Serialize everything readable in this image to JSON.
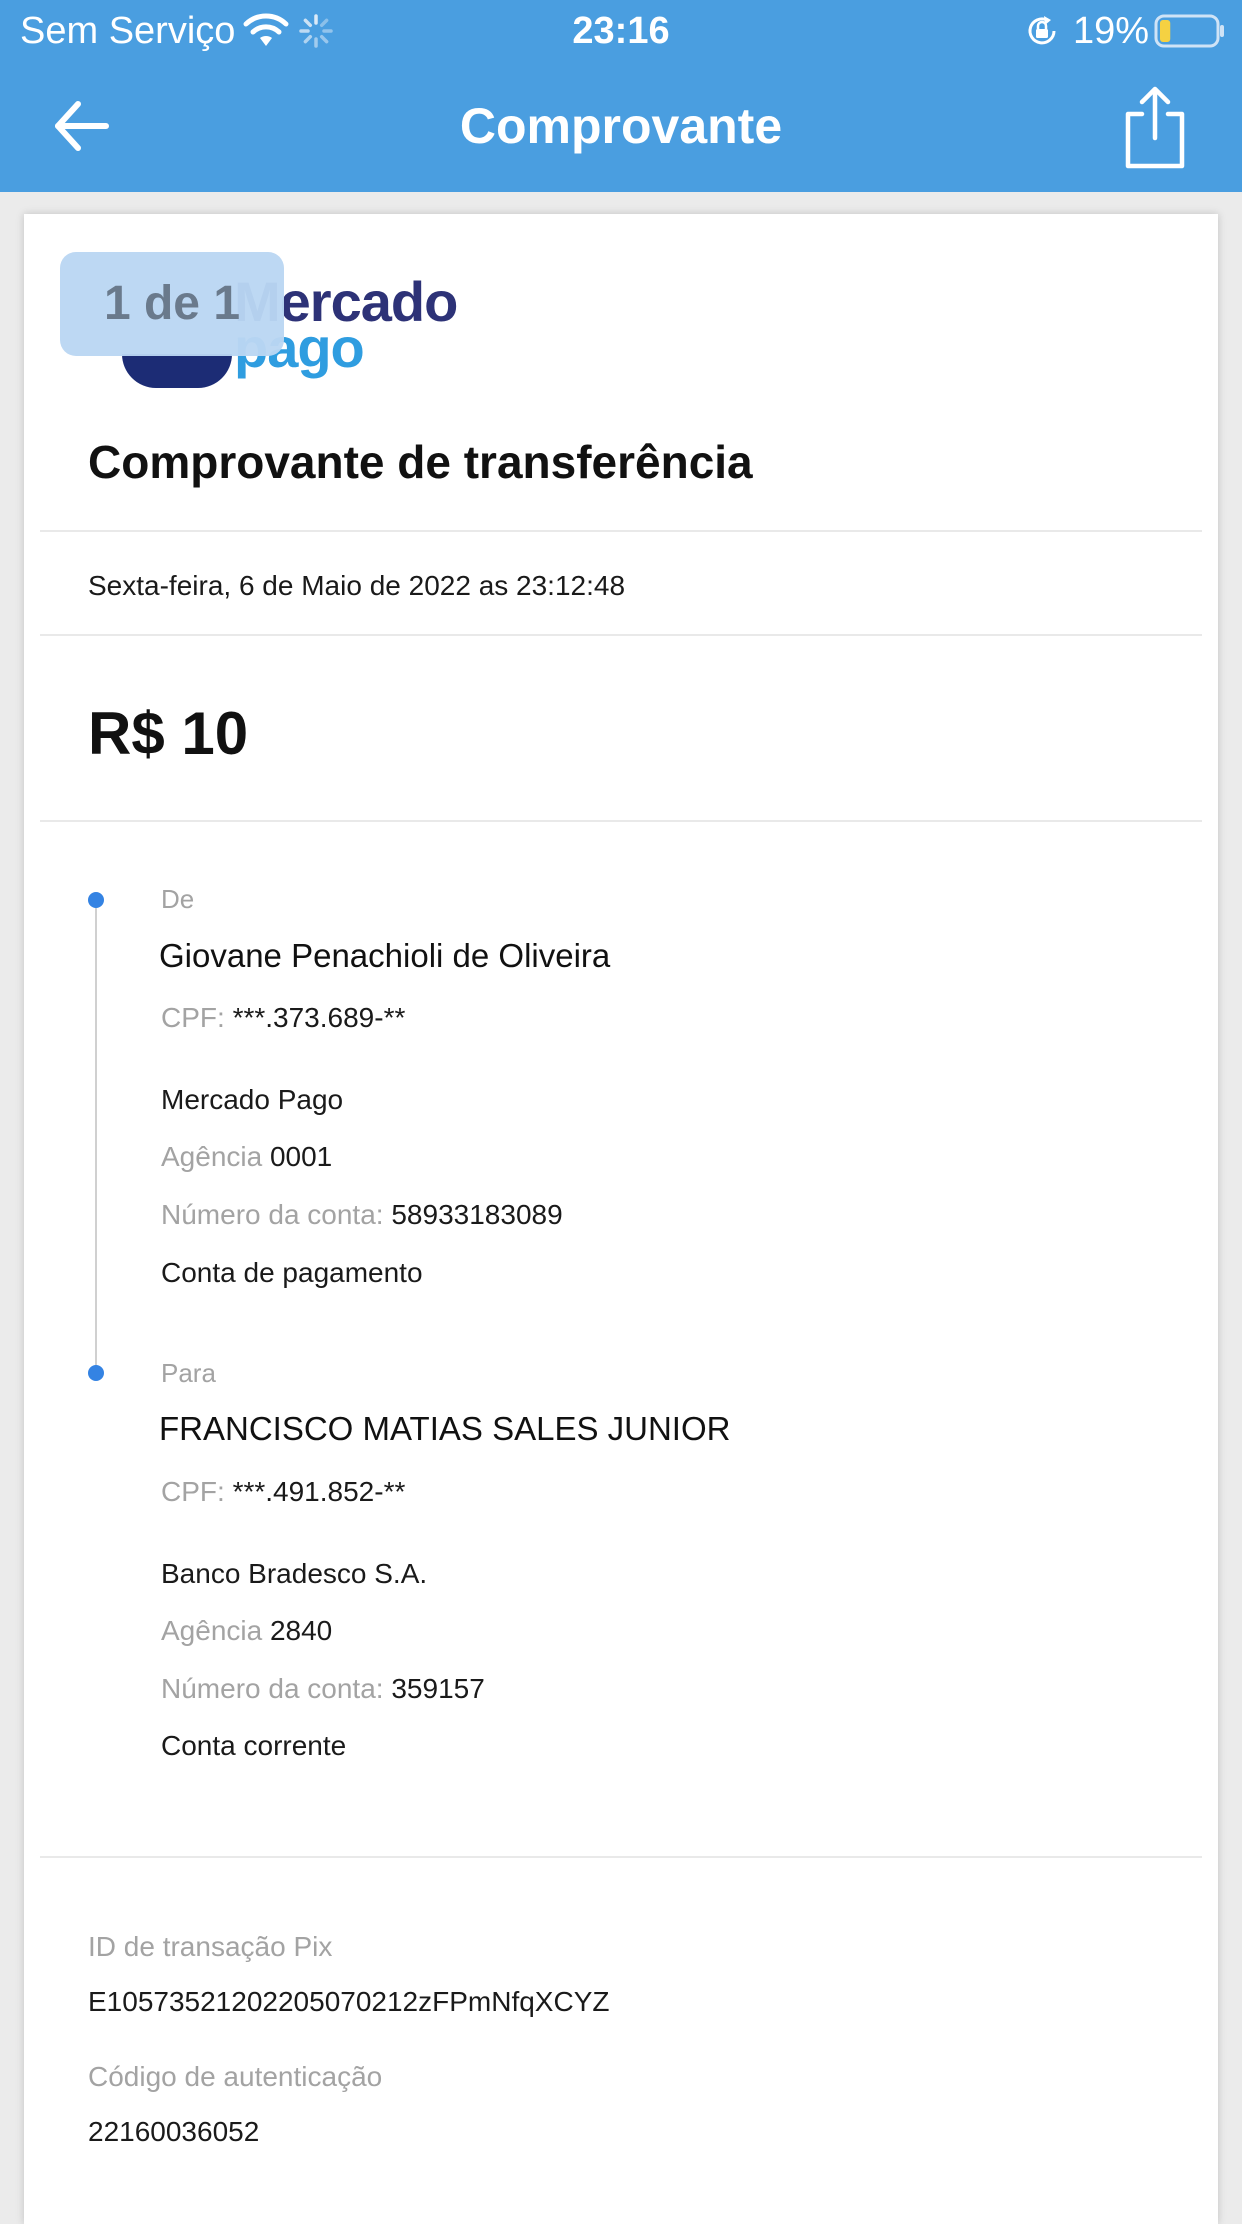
{
  "status_bar": {
    "carrier": "Sem Serviço",
    "time": "23:16",
    "battery_percent": "19%",
    "battery_level": 0.19,
    "battery_fill_color": "#f5d142",
    "icons": [
      "wifi-icon",
      "loading-spinner-icon",
      "rotation-lock-icon",
      "battery-icon"
    ]
  },
  "nav": {
    "title": "Comprovante",
    "back_icon": "arrow-left-icon",
    "share_icon": "share-icon"
  },
  "colors": {
    "header_bg": "#4a9ee0",
    "accent_dot": "#3483e3",
    "muted_text": "#a3a3a3",
    "logo_dark": "#2d3277",
    "logo_light": "#2f9de0"
  },
  "logo": {
    "line1": "Mercado",
    "line2": "pago"
  },
  "page_indicator": "1 de 1",
  "receipt": {
    "title": "Comprovante de transferência",
    "date": "Sexta-feira, 6 de Maio de 2022 as 23:12:48",
    "amount": "R$ 10",
    "from": {
      "label": "De",
      "name": "Giovane Penachioli de Oliveira",
      "cpf_label": "CPF:",
      "cpf_value": "***.373.689-**",
      "bank": "Mercado Pago",
      "agency_label": "Agência",
      "agency_value": "0001",
      "account_label": "Número da conta:",
      "account_value": "58933183089",
      "account_type": "Conta de pagamento"
    },
    "to": {
      "label": "Para",
      "name": "FRANCISCO MATIAS SALES JUNIOR",
      "cpf_label": "CPF:",
      "cpf_value": "***.491.852-**",
      "bank": "Banco Bradesco S.A.",
      "agency_label": "Agência",
      "agency_value": "2840",
      "account_label": "Número da conta:",
      "account_value": "359157",
      "account_type": "Conta corrente"
    },
    "pix_id_label": "ID de transação Pix",
    "pix_id_value": "E10573521202205070212zFPmNfqXCYZ",
    "auth_label": "Código de autenticação",
    "auth_value": "22160036052"
  }
}
